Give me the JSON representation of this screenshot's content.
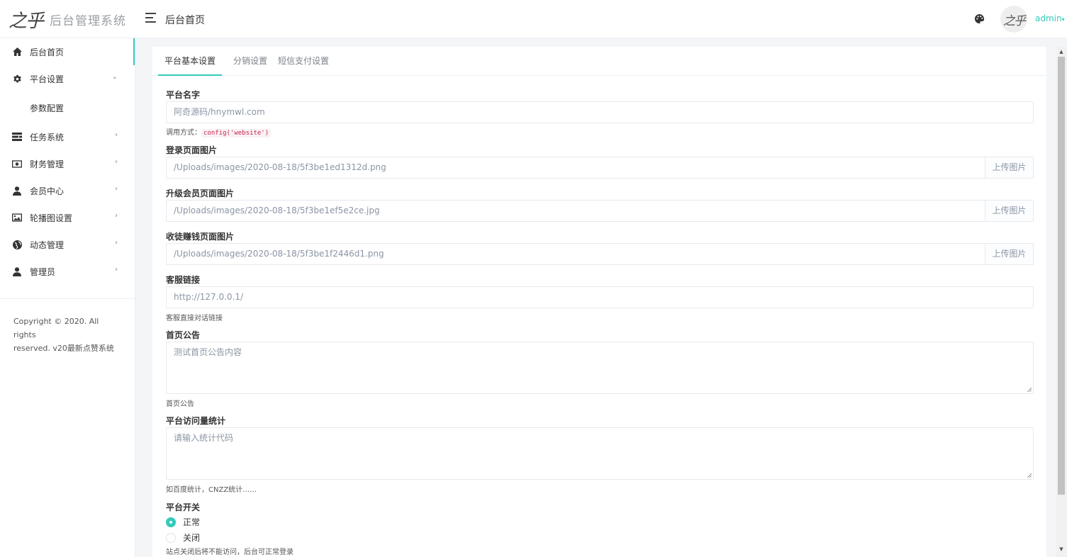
{
  "header": {
    "logo_mark": "之乎",
    "logo_text": "后台管理系统",
    "title": "后台首页",
    "avatar_text": "之乎",
    "user_label": "admin",
    "accent": "#33cabb"
  },
  "sidebar": {
    "items": [
      {
        "label": "后台首页",
        "icon": "home-icon",
        "arrow": ""
      },
      {
        "label": "平台设置",
        "icon": "gear-icon",
        "arrow": "⌄"
      },
      {
        "label": "参数配置"
      },
      {
        "label": "任务系统",
        "icon": "tasks-icon",
        "arrow": "›"
      },
      {
        "label": "财务管理",
        "icon": "money-icon",
        "arrow": "›"
      },
      {
        "label": "会员中心",
        "icon": "user-icon",
        "arrow": "›"
      },
      {
        "label": "轮播图设置",
        "icon": "image-icon",
        "arrow": "›"
      },
      {
        "label": "动态管理",
        "icon": "globe-icon",
        "arrow": "›"
      },
      {
        "label": "管理员",
        "icon": "admin-icon",
        "arrow": "›"
      }
    ],
    "copyright_line1": "Copyright © 2020. All rights",
    "copyright_line2": "reserved. v20最新点赞系统"
  },
  "tabs": [
    "平台基本设置",
    "分销设置",
    "短信支付设置"
  ],
  "form": {
    "site_name": {
      "label": "平台名字",
      "placeholder": "阿奇源码/hnymwl.com",
      "help_prefix": "调用方式：",
      "help_code": "config('website')"
    },
    "login_image": {
      "label": "登录页面图片",
      "value": "/Uploads/images/2020-08-18/5f3be1ed1312d.png",
      "button": "上传图片"
    },
    "upgrade_image": {
      "label": "升级会员页面图片",
      "value": "/Uploads/images/2020-08-18/5f3be1ef5e2ce.jpg",
      "button": "上传图片"
    },
    "recruit_image": {
      "label": "收徒赚钱页面图片",
      "value": "/Uploads/images/2020-08-18/5f3be1f2446d1.png",
      "button": "上传图片"
    },
    "service_link": {
      "label": "客服链接",
      "value": "http://127.0.0.1/",
      "help": "客服直接对话链接"
    },
    "notice": {
      "label": "首页公告",
      "value": "测试首页公告内容",
      "help": "首页公告"
    },
    "stats": {
      "label": "平台访问量统计",
      "placeholder": "请输入统计代码",
      "help": "如百度统计，CNZZ统计……"
    },
    "switch": {
      "label": "平台开关",
      "options": [
        "正常",
        "关闭"
      ],
      "selected": "正常",
      "help": "站点关闭后将不能访问，后台可正常登录"
    }
  }
}
